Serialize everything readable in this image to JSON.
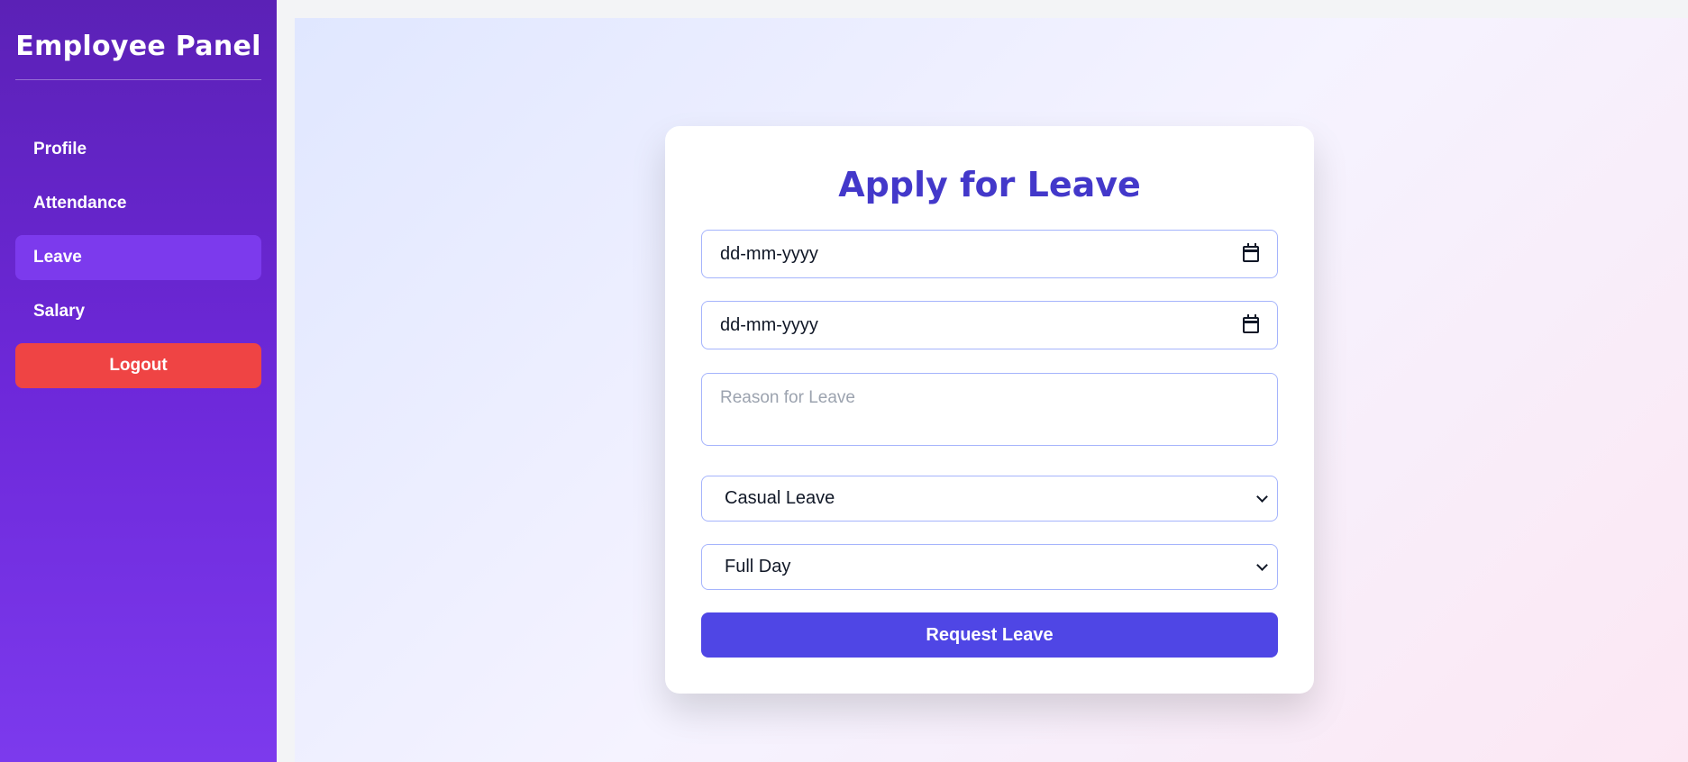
{
  "sidebar": {
    "title": "Employee Panel",
    "items": [
      {
        "label": "Profile",
        "active": false
      },
      {
        "label": "Attendance",
        "active": false
      },
      {
        "label": "Leave",
        "active": true
      },
      {
        "label": "Salary",
        "active": false
      }
    ],
    "logout_label": "Logout"
  },
  "form": {
    "title": "Apply for Leave",
    "start_date_placeholder": "dd-mm-yyyy",
    "end_date_placeholder": "dd-mm-yyyy",
    "reason_placeholder": "Reason for Leave",
    "leave_type_selected": "Casual Leave",
    "duration_selected": "Full Day",
    "submit_label": "Request Leave"
  },
  "colors": {
    "sidebar_gradient_top": "#5b21b6",
    "sidebar_gradient_bottom": "#7c3aed",
    "active_item": "#7c3aed",
    "logout": "#ef4444",
    "title": "#4338ca",
    "submit": "#4f46e5",
    "field_border": "#a5b4fc"
  },
  "icons": {
    "date_picker": "calendar-icon",
    "select": "chevron-down-icon"
  }
}
